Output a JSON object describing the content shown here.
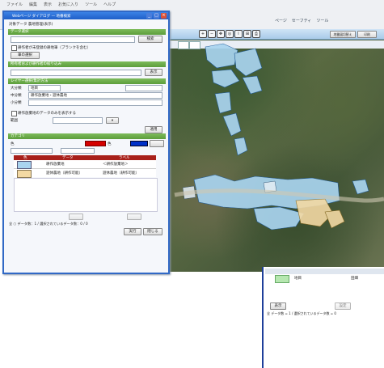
{
  "browser": {
    "menu": [
      "ファイル",
      "編集",
      "表示",
      "お気に入り",
      "ツール",
      "ヘルプ"
    ],
    "toolbar": [
      "ページ",
      "セーフティ",
      "ツール"
    ],
    "right_buttons": [
      "地番図切替え",
      "印刷"
    ]
  },
  "dialog": {
    "title": "Webページ ダイアログ — 地番検索",
    "tab_title": "対象データ 農地管理(表示)",
    "section1": "データ選択",
    "section2": "所有者および耕作者の絞り込み",
    "section3": "レイヤー選択/集計方法",
    "section4": "カテゴリ",
    "check1": "耕作者が未登録の耕地筆（ブランクを含む）",
    "button_search": "検索",
    "button_select": "筆の選択",
    "button_apply": "適用",
    "button_go": "表示",
    "field_label_a": "大分類",
    "field_label_b": "中分類",
    "field_label_c": "小分類",
    "field_value_a": "地目",
    "field_value_b": "耕作放棄地・遊休農地",
    "check2": "耕作放棄地のデータのみを表示する",
    "range_label": "範囲",
    "color_label_a": "色",
    "color_label_b": "色",
    "legend_headers": [
      "色",
      "データ",
      "ラベル"
    ],
    "legend_rows": [
      {
        "color": "#a9d4ef",
        "name": "耕作放棄地",
        "label": "＜耕作放棄地＞"
      },
      {
        "color": "#f3d9a4",
        "name": "遊休農地（耕作可能）",
        "label": "遊休農地（耕作可能）"
      }
    ],
    "footer_text": "全 ○ データ数：1 /  選択されているデータ数：0 / 0",
    "btn_ok": "実行",
    "btn_close": "閉じる",
    "colors": {
      "red": "#d40000",
      "blue": "#0030c8"
    }
  },
  "lower_panel": {
    "cells": [
      "地目",
      "田畑"
    ],
    "buttons": [
      "表示",
      "設定"
    ],
    "footer_text": "全 データ数 = 1 / 選択されているデータ数 = 0"
  }
}
